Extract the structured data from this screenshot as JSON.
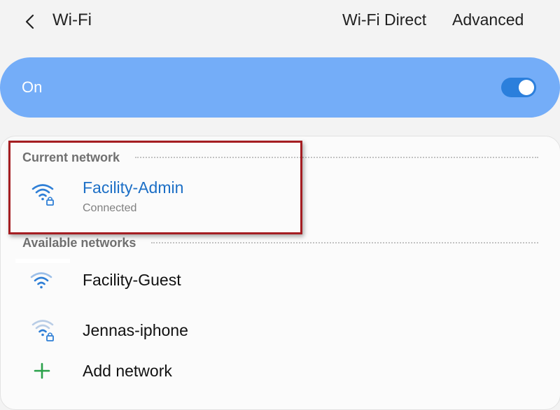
{
  "header": {
    "title": "Wi-Fi",
    "wifi_direct_label": "Wi-Fi Direct",
    "advanced_label": "Advanced"
  },
  "master_toggle": {
    "label": "On",
    "state": "on"
  },
  "current_network": {
    "section_label": "Current network",
    "name": "Facility-Admin",
    "status": "Connected",
    "icon": "wifi-lock-icon"
  },
  "available_networks": {
    "section_label": "Available networks",
    "items": [
      {
        "name": "Facility-Guest",
        "icon": "wifi-icon"
      },
      {
        "name": "Jennas-iphone",
        "icon": "wifi-lock-icon"
      }
    ],
    "add_label": "Add network"
  },
  "colors": {
    "accent": "#2b7fdc",
    "on_bar": "#74adf8",
    "active_text": "#1c6fc6",
    "highlight": "#a51e22",
    "add_icon": "#2aa14a"
  }
}
